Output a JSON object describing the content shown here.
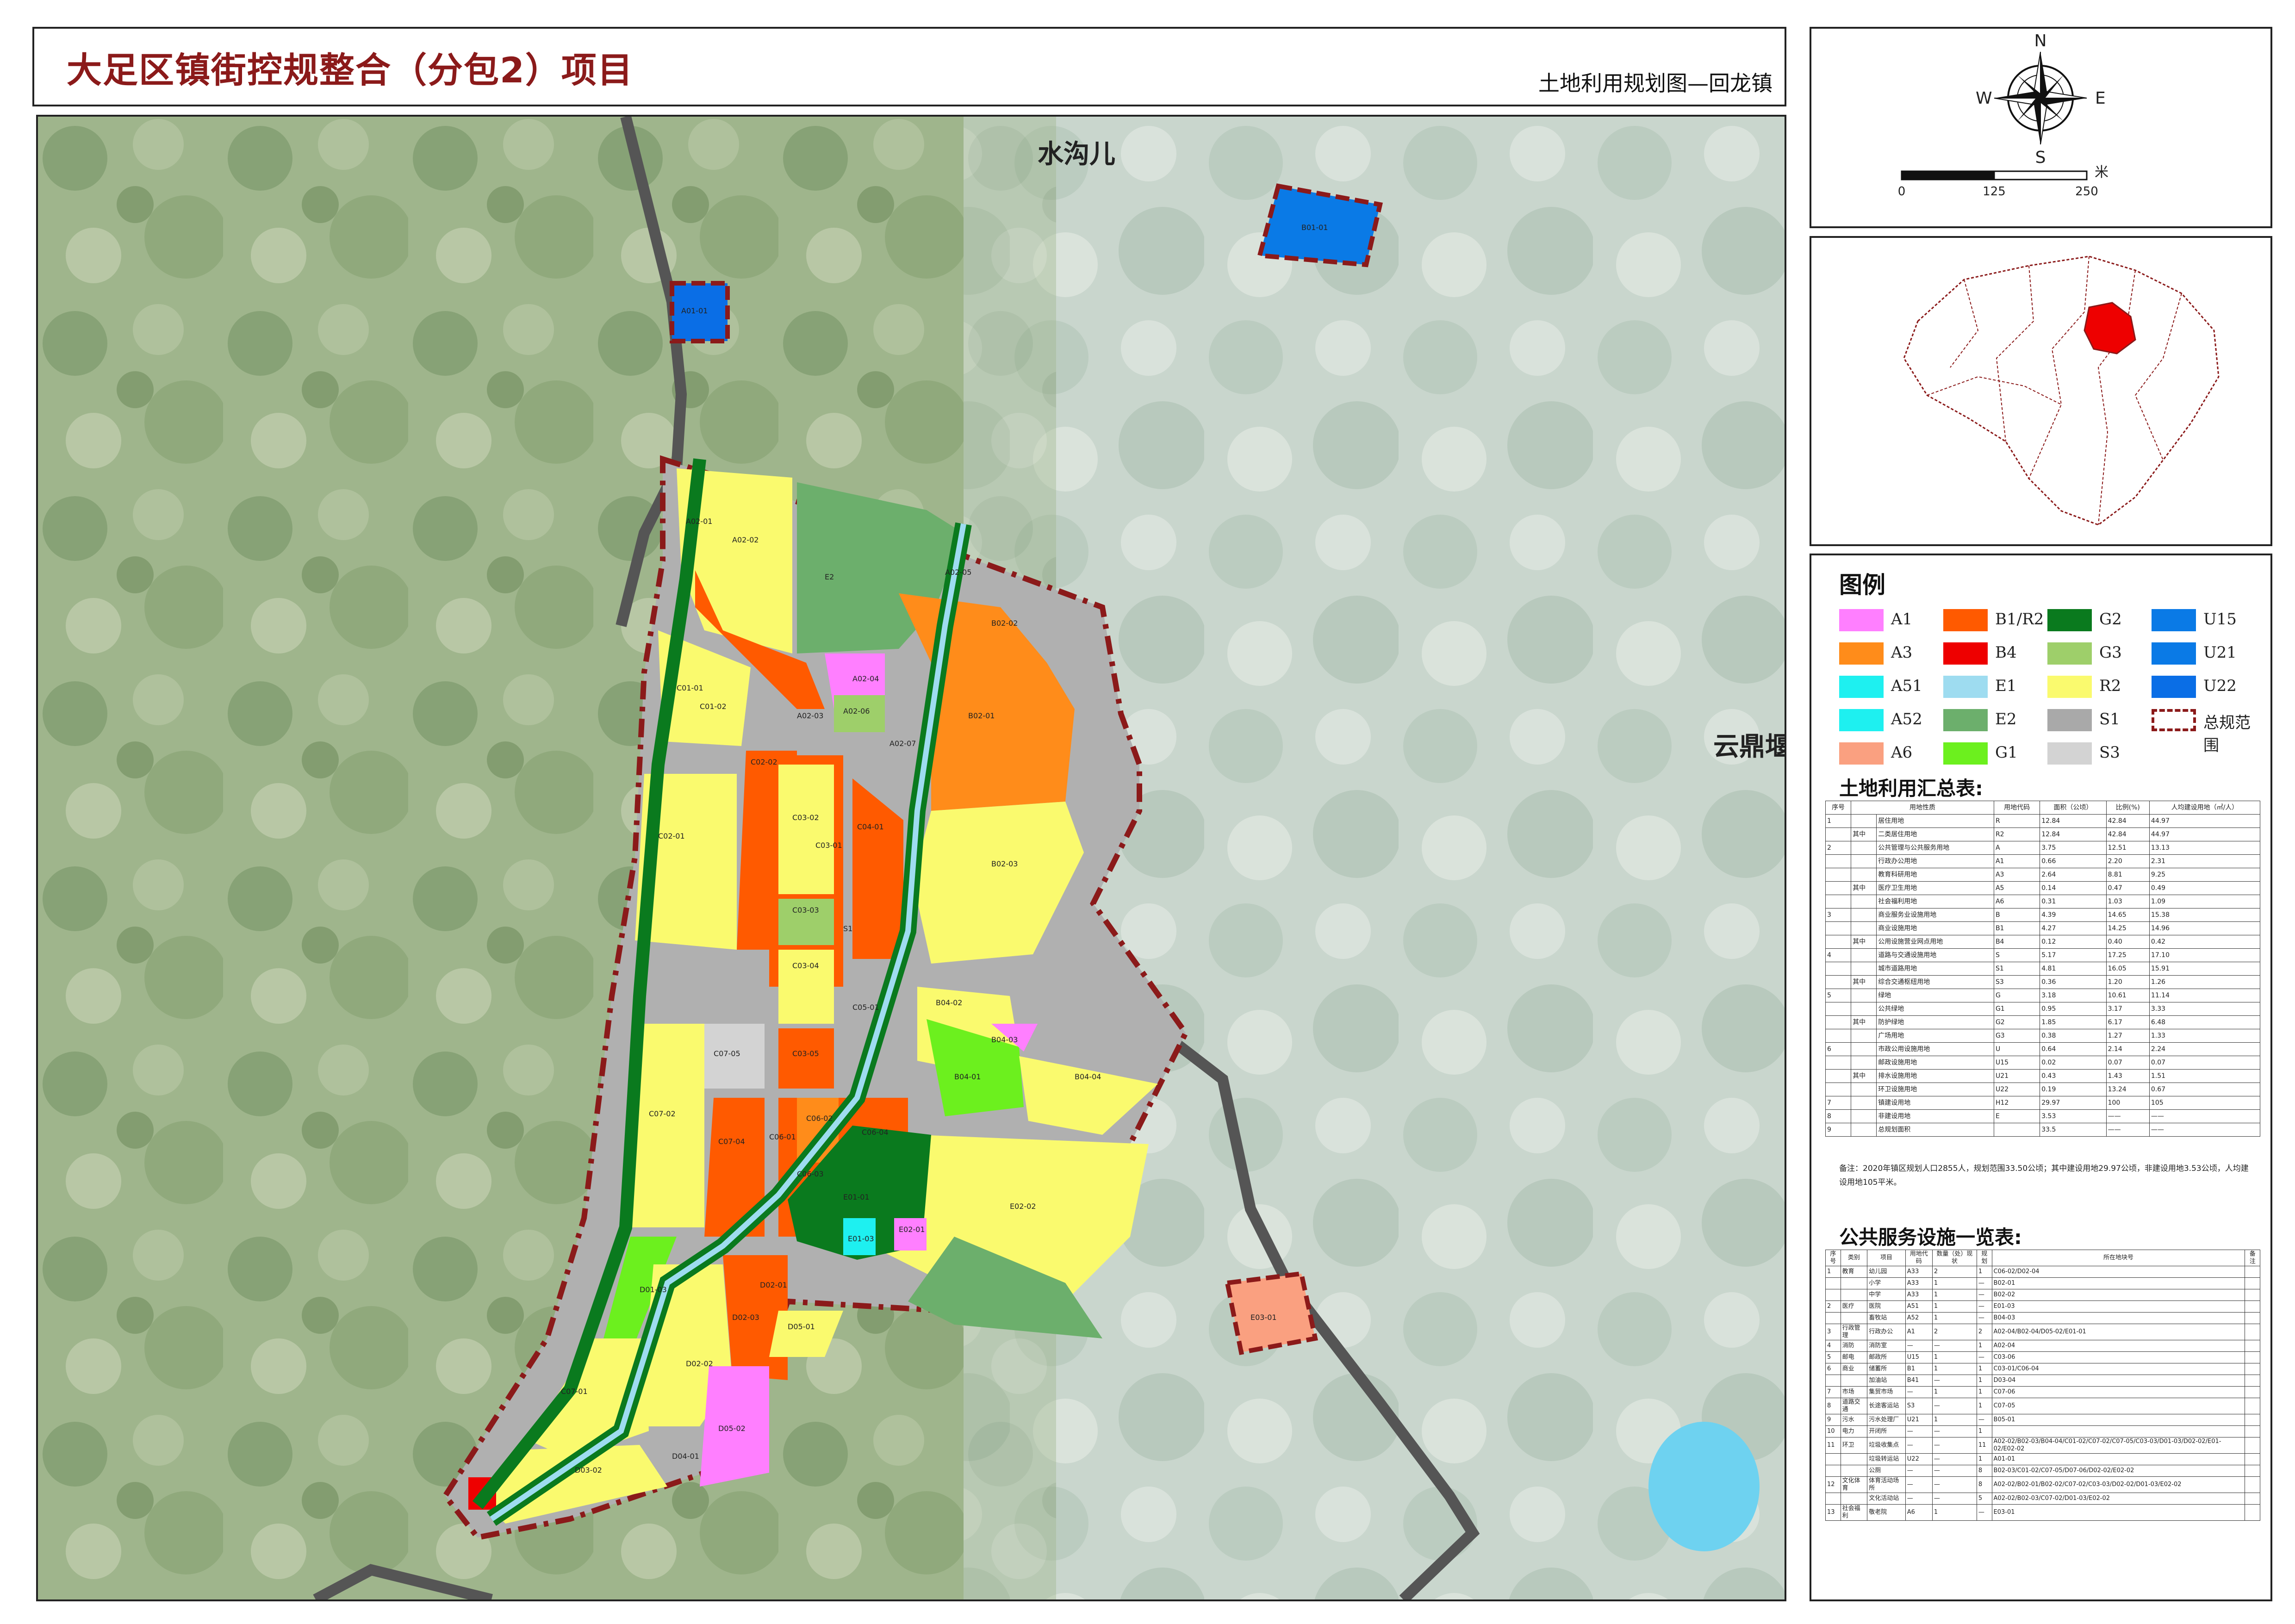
{
  "title": {
    "main": "大足区镇街控规整合（分包2）项目",
    "sub": "土地利用规划图—回龙镇"
  },
  "compass": {
    "n": "N",
    "s": "S",
    "e": "E",
    "w": "W"
  },
  "scale_bar": {
    "labels": [
      "0",
      "125",
      "250"
    ],
    "unit": "米"
  },
  "map": {
    "place_labels": [
      "水沟儿",
      "云鼎堰"
    ],
    "parcels": [
      {
        "code": "A02-01",
        "use": "R2"
      },
      {
        "code": "A02-02",
        "use": "R2"
      },
      {
        "code": "E2",
        "use": ""
      },
      {
        "code": "A02-05",
        "use": "G2"
      },
      {
        "code": "B02-02",
        "use": "A3"
      },
      {
        "code": "A02-04",
        "use": "A1"
      },
      {
        "code": "A02-06",
        "use": "G3"
      },
      {
        "code": "A02-03",
        "use": "B1/R2"
      },
      {
        "code": "A02-07",
        "use": "R2"
      },
      {
        "code": "B02-01",
        "use": "A3"
      },
      {
        "code": "C01-01",
        "use": "R2"
      },
      {
        "code": "C01-02",
        "use": "R2"
      },
      {
        "code": "C02-02",
        "use": "B1/R2"
      },
      {
        "code": "C03-02",
        "use": "R2"
      },
      {
        "code": "C03-01",
        "use": "B1/R2"
      },
      {
        "code": "C04-01",
        "use": "B1/R2"
      },
      {
        "code": "C02-01",
        "use": "R2"
      },
      {
        "code": "C03-03",
        "use": "G3"
      },
      {
        "code": "B02-03",
        "use": "R2"
      },
      {
        "code": "C03-04",
        "use": "R2"
      },
      {
        "code": "B04-02",
        "use": "R2"
      },
      {
        "code": "B04-03",
        "use": "A52"
      },
      {
        "code": "C07-05",
        "use": "S3"
      },
      {
        "code": "C03-05",
        "use": "B1/R2"
      },
      {
        "code": "C05-01",
        "use": "B1/R2"
      },
      {
        "code": "B04-01",
        "use": "G1"
      },
      {
        "code": "B04-04",
        "use": "R2"
      },
      {
        "code": "C07-02",
        "use": "R2"
      },
      {
        "code": "C06-02",
        "use": "A3"
      },
      {
        "code": "C06-04",
        "use": "B1/R2"
      },
      {
        "code": "C07-04",
        "use": "B1/R2"
      },
      {
        "code": "C06-01",
        "use": "B1/R2"
      },
      {
        "code": "C06-03",
        "use": "R2"
      },
      {
        "code": "E01-01",
        "use": "G2"
      },
      {
        "code": "E02-02",
        "use": "R2"
      },
      {
        "code": "E02-01",
        "use": "A1"
      },
      {
        "code": "D01-03",
        "use": "G1"
      },
      {
        "code": "E01-03",
        "use": "A51"
      },
      {
        "code": "D02-01",
        "use": "B1/R2"
      },
      {
        "code": "D02-03",
        "use": "B1/R2"
      },
      {
        "code": "D02-02",
        "use": "R2"
      },
      {
        "code": "D05-01",
        "use": "R2"
      },
      {
        "code": "C07-01",
        "use": "R2"
      },
      {
        "code": "D03-02",
        "use": "R2"
      },
      {
        "code": "D04-01",
        "use": "R2"
      },
      {
        "code": "D05-02",
        "use": "A1"
      },
      {
        "code": "E03-01",
        "use": "A6"
      },
      {
        "code": "A01-01",
        "use": "U22"
      },
      {
        "code": "B01-01",
        "use": "U21"
      },
      {
        "code": "S1",
        "use": ""
      }
    ]
  },
  "legend": {
    "title": "图例",
    "items": [
      {
        "code": "A1",
        "color": "#FF7FFF"
      },
      {
        "code": "B1/R2",
        "color": "#FF5A00"
      },
      {
        "code": "G2",
        "color": "#0A7A1E"
      },
      {
        "code": "U15",
        "color": "#0A7AE6"
      },
      {
        "code": "A3",
        "color": "#FF8C1A"
      },
      {
        "code": "B4",
        "color": "#EE0000"
      },
      {
        "code": "G3",
        "color": "#9ECF6A"
      },
      {
        "code": "U21",
        "color": "#0A7AE6"
      },
      {
        "code": "A51",
        "color": "#1EF0F0"
      },
      {
        "code": "E1",
        "color": "#9EDCF0"
      },
      {
        "code": "R2",
        "color": "#FAFA6E"
      },
      {
        "code": "U22",
        "color": "#0A6EE6"
      },
      {
        "code": "A52",
        "color": "#1EF0F0"
      },
      {
        "code": "E2",
        "color": "#6CAF6C"
      },
      {
        "code": "S1",
        "color": "#A9A9A9"
      },
      {
        "code": "总规范围",
        "color": "#8B1A1A"
      },
      {
        "code": "A6",
        "color": "#FAA080"
      },
      {
        "code": "G1",
        "color": "#6CF01E"
      },
      {
        "code": "S3",
        "color": "#D3D3D3"
      }
    ]
  },
  "summary": {
    "title": "土地利用汇总表:",
    "headers": [
      "序号",
      "用地性质",
      "用地代码",
      "面积（公顷）",
      "比例(%)",
      "人均建设用地（㎡/人）"
    ],
    "rows": [
      [
        "1",
        "",
        "居住用地",
        "R",
        "12.84",
        "42.84",
        "44.97"
      ],
      [
        "",
        "其中",
        "二类居住用地",
        "R2",
        "12.84",
        "42.84",
        "44.97"
      ],
      [
        "2",
        "",
        "公共管理与公共服务用地",
        "A",
        "3.75",
        "12.51",
        "13.13"
      ],
      [
        "",
        "",
        "行政办公用地",
        "A1",
        "0.66",
        "2.20",
        "2.31"
      ],
      [
        "",
        "",
        "教育科研用地",
        "A3",
        "2.64",
        "8.81",
        "9.25"
      ],
      [
        "",
        "其中",
        "医疗卫生用地",
        "A5",
        "0.14",
        "0.47",
        "0.49"
      ],
      [
        "",
        "",
        "社会福利用地",
        "A6",
        "0.31",
        "1.03",
        "1.09"
      ],
      [
        "3",
        "",
        "商业服务业设施用地",
        "B",
        "4.39",
        "14.65",
        "15.38"
      ],
      [
        "",
        "",
        "商业设施用地",
        "B1",
        "4.27",
        "14.25",
        "14.96"
      ],
      [
        "",
        "其中",
        "公用设施营业网点用地",
        "B4",
        "0.12",
        "0.40",
        "0.42"
      ],
      [
        "4",
        "",
        "道路与交通设施用地",
        "S",
        "5.17",
        "17.25",
        "17.10"
      ],
      [
        "",
        "",
        "城市道路用地",
        "S1",
        "4.81",
        "16.05",
        "15.91"
      ],
      [
        "",
        "其中",
        "综合交通枢纽用地",
        "S3",
        "0.36",
        "1.20",
        "1.26"
      ],
      [
        "5",
        "",
        "绿地",
        "G",
        "3.18",
        "10.61",
        "11.14"
      ],
      [
        "",
        "",
        "公共绿地",
        "G1",
        "0.95",
        "3.17",
        "3.33"
      ],
      [
        "",
        "其中",
        "防护绿地",
        "G2",
        "1.85",
        "6.17",
        "6.48"
      ],
      [
        "",
        "",
        "广场用地",
        "G3",
        "0.38",
        "1.27",
        "1.33"
      ],
      [
        "6",
        "",
        "市政公用设施用地",
        "U",
        "0.64",
        "2.14",
        "2.24"
      ],
      [
        "",
        "",
        "邮政设施用地",
        "U15",
        "0.02",
        "0.07",
        "0.07"
      ],
      [
        "",
        "其中",
        "排水设施用地",
        "U21",
        "0.43",
        "1.43",
        "1.51"
      ],
      [
        "",
        "",
        "环卫设施用地",
        "U22",
        "0.19",
        "13.24",
        "0.67"
      ],
      [
        "7",
        "",
        "镇建设用地",
        "H12",
        "29.97",
        "100",
        "105"
      ],
      [
        "8",
        "",
        "非建设用地",
        "E",
        "3.53",
        "——",
        "——"
      ],
      [
        "9",
        "",
        "总规划面积",
        "",
        "33.5",
        "——",
        "——"
      ]
    ],
    "note": "备注：2020年镇区规划人口2855人，规划范围33.50公顷；其中建设用地29.97公顷，非建设用地3.53公顷，人均建设用地105平米。"
  },
  "services": {
    "title": "公共服务设施一览表:",
    "headers": [
      "序号",
      "类别",
      "项目",
      "用地代码",
      "数量（处）现状",
      "规划",
      "所在地块号",
      "备注"
    ],
    "rows": [
      [
        "1",
        "教育",
        "幼儿园",
        "A33",
        "2",
        "1",
        "C06-02/D02-04",
        ""
      ],
      [
        "",
        "",
        "小学",
        "A33",
        "1",
        "—",
        "B02-01",
        ""
      ],
      [
        "",
        "",
        "中学",
        "A33",
        "1",
        "—",
        "B02-02",
        ""
      ],
      [
        "2",
        "医疗",
        "医院",
        "A51",
        "1",
        "—",
        "E01-03",
        ""
      ],
      [
        "",
        "",
        "畜牧站",
        "A52",
        "1",
        "—",
        "B04-03",
        ""
      ],
      [
        "3",
        "行政管理",
        "行政办公",
        "A1",
        "2",
        "2",
        "A02-04/B02-04/D05-02/E01-01",
        ""
      ],
      [
        "4",
        "消防",
        "消防室",
        "—",
        "—",
        "1",
        "A02-04",
        ""
      ],
      [
        "5",
        "邮电",
        "邮政所",
        "U15",
        "1",
        "—",
        "C03-06",
        ""
      ],
      [
        "6",
        "商业",
        "储蓄所",
        "B1",
        "1",
        "1",
        "C03-01/C06-04",
        ""
      ],
      [
        "",
        "",
        "加油站",
        "B41",
        "—",
        "1",
        "D03-04",
        ""
      ],
      [
        "7",
        "市场",
        "集贸市场",
        "—",
        "1",
        "1",
        "C07-06",
        ""
      ],
      [
        "8",
        "道路交通",
        "长途客运站",
        "S3",
        "—",
        "1",
        "C07-05",
        ""
      ],
      [
        "9",
        "污水",
        "污水处理厂",
        "U21",
        "1",
        "—",
        "B05-01",
        ""
      ],
      [
        "10",
        "电力",
        "开闭所",
        "—",
        "—",
        "1",
        "",
        ""
      ],
      [
        "11",
        "环卫",
        "垃圾收集点",
        "—",
        "—",
        "11",
        "A02-02/B02-03/B04-04/C01-02/C07-02/C07-05/C03-03/D01-03/D02-02/E01-02/E02-02",
        ""
      ],
      [
        "",
        "",
        "垃圾转运站",
        "U22",
        "—",
        "1",
        "A01-01",
        ""
      ],
      [
        "",
        "",
        "公厕",
        "—",
        "—",
        "8",
        "B02-03/C01-02/C07-05/D07-06/D02-02/E02-02",
        ""
      ],
      [
        "12",
        "文化体育",
        "体育活动场所",
        "—",
        "—",
        "8",
        "A02-02/B02-01/B02-02/C07-02/C03-03/D02-02/D01-03/E02-02",
        ""
      ],
      [
        "",
        "",
        "文化活动站",
        "—",
        "—",
        "5",
        "A02-02/B02-03/C07-02/D01-03/E02-02",
        ""
      ],
      [
        "13",
        "社会福利",
        "敬老院",
        "A6",
        "1",
        "—",
        "E03-01",
        ""
      ]
    ]
  }
}
